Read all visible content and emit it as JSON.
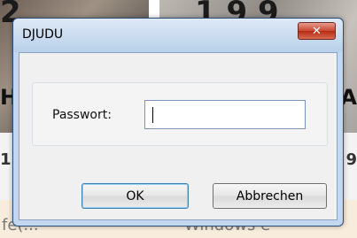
{
  "dialog": {
    "title": "DJUDU",
    "close_glyph": "✕",
    "password_label": "Passwort:",
    "password_value": "",
    "ok_label": "OK",
    "cancel_label": "Abbrechen"
  },
  "background": {
    "top_left_text": "2",
    "top_right_text": "1 9 9",
    "left_edge_text": "H",
    "right_edge_text": "A",
    "left_edge_text2": "1",
    "right_edge_text2": "9",
    "bottom_left_text": "fe(...",
    "bottom_right_text": "Windows e"
  }
}
